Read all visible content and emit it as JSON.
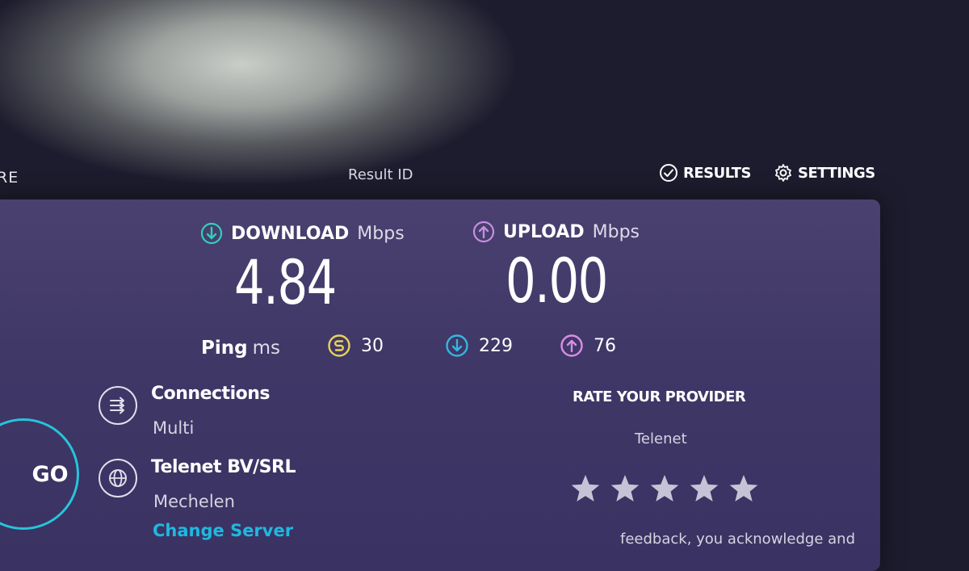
{
  "nav": {
    "left_label": "RE",
    "result_id_label": "Result ID",
    "results_label": "RESULTS",
    "settings_label": "SETTINGS"
  },
  "download": {
    "label": "DOWNLOAD",
    "unit": "Mbps",
    "value": "4.84",
    "icon": "download-arrow-icon",
    "color": "#2fd1b8"
  },
  "upload": {
    "label": "UPLOAD",
    "unit": "Mbps",
    "value": "0.00",
    "icon": "upload-arrow-icon",
    "color": "#c78ee0"
  },
  "ping": {
    "label": "Ping",
    "unit": "ms",
    "idle": {
      "value": "30",
      "icon": "idle-ping-icon",
      "color": "#e8d35a"
    },
    "download": {
      "value": "229",
      "icon": "download-ping-icon",
      "color": "#35b6e0"
    },
    "upload": {
      "value": "76",
      "icon": "upload-ping-icon",
      "color": "#d98ee6"
    }
  },
  "go_button": {
    "label": "GO",
    "color": "#27c4da"
  },
  "connections": {
    "title": "Connections",
    "value": "Multi",
    "icon": "connections-icon"
  },
  "server": {
    "host": "Telenet BV/SRL",
    "location": "Mechelen",
    "change_label": "Change Server",
    "icon": "globe-icon"
  },
  "rate": {
    "title": "RATE YOUR PROVIDER",
    "provider": "Telenet",
    "stars_total": 5,
    "stars_selected": 0,
    "disclaimer": "feedback, you acknowledge and"
  }
}
